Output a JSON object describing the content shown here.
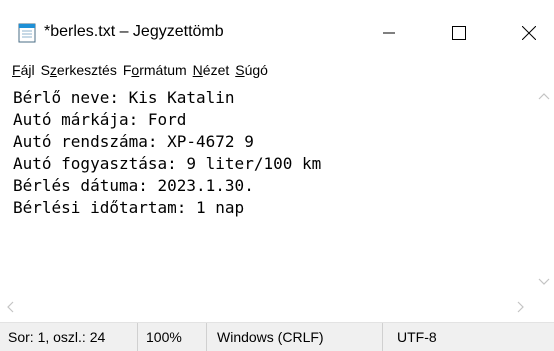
{
  "window": {
    "title": "*berles.txt – Jegyzettömb",
    "app_icon": "notepad-icon",
    "controls": [
      "minimize-icon",
      "maximize-icon",
      "close-icon"
    ]
  },
  "menu": {
    "items": [
      {
        "mnemonic": "F",
        "rest": "ájl"
      },
      {
        "pre": "S",
        "mnemonic": "z",
        "rest": "erkesztés"
      },
      {
        "pre": "F",
        "mnemonic": "o",
        "rest": "rmátum"
      },
      {
        "mnemonic": "N",
        "rest": "ézet"
      },
      {
        "mnemonic": "S",
        "rest": "úgó"
      }
    ]
  },
  "editor": {
    "lines": [
      "Bérlő neve: Kis Katalin",
      "Autó márkája: Ford",
      "Autó rendszáma: XP-4672 9",
      "Autó fogyasztása: 9 liter/100 km",
      "Bérlés dátuma: 2023.1.30.",
      "Bérlési időtartam: 1 nap"
    ]
  },
  "statusbar": {
    "position": "Sor: 1, oszl.: 24",
    "zoom": "100%",
    "line_endings": "Windows (CRLF)",
    "encoding": "UTF-8"
  },
  "colors": {
    "statusbar_bg": "#f0f0f0",
    "scroll_arrow": "#c4c4c4",
    "icon_blue": "#1e90d6"
  }
}
